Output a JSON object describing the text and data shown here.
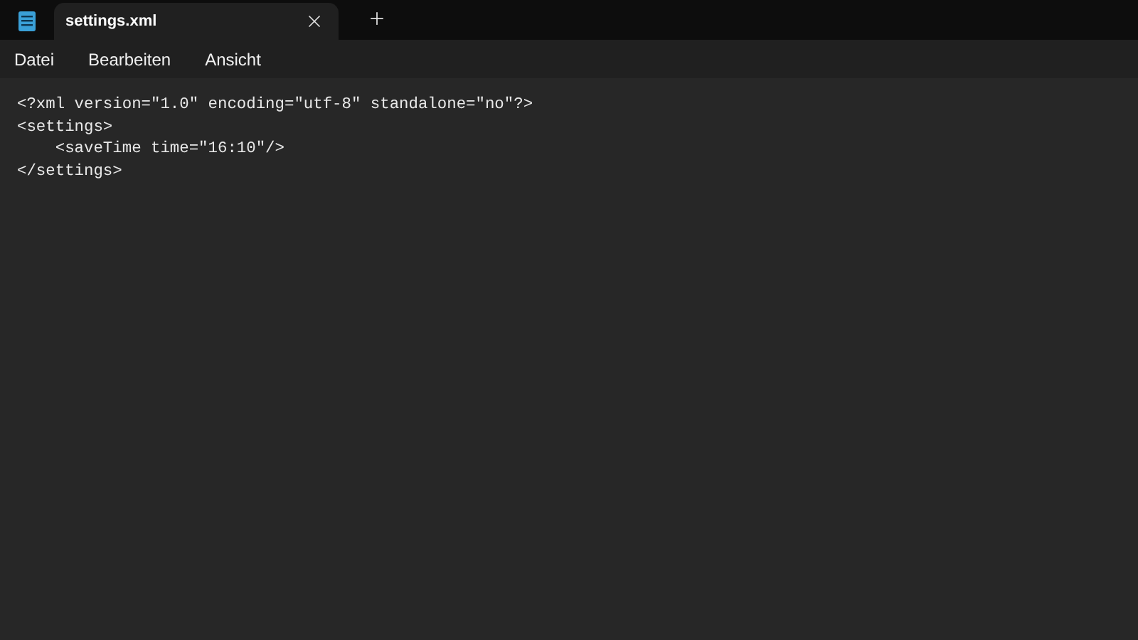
{
  "tabs": [
    {
      "title": "settings.xml",
      "selected": true
    }
  ],
  "menu": [
    "Datei",
    "Bearbeiten",
    "Ansicht"
  ],
  "editor": {
    "lines": [
      "<?xml version=\"1.0\" encoding=\"utf-8\" standalone=\"no\"?>",
      "<settings>",
      "    <saveTime time=\"16:10\"/>",
      "</settings>"
    ]
  }
}
